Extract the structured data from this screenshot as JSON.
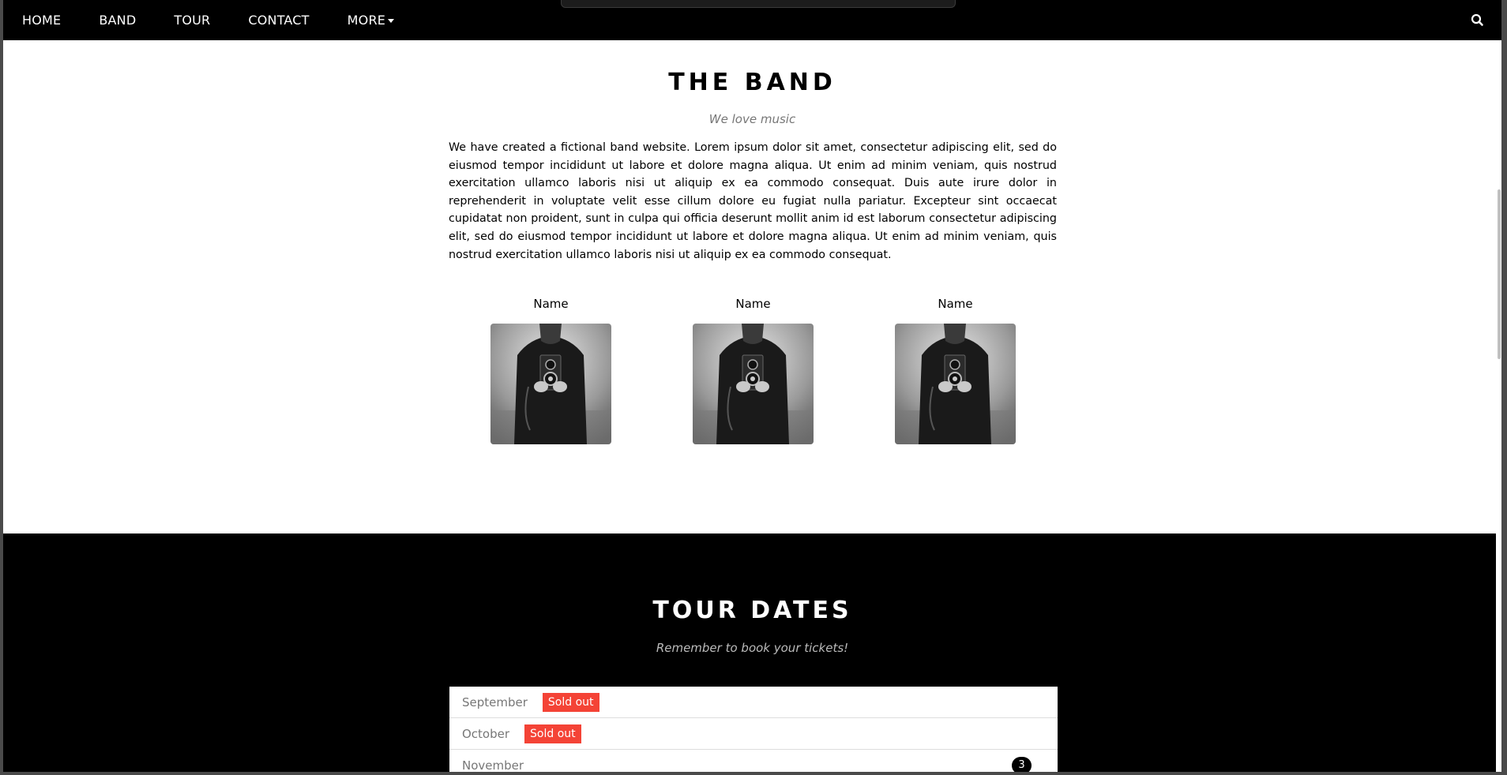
{
  "nav": {
    "items": [
      "HOME",
      "BAND",
      "TOUR",
      "CONTACT",
      "MORE"
    ],
    "search_icon": "search-icon"
  },
  "band": {
    "title": "THE BAND",
    "subtitle": "We love music",
    "description": "We have created a fictional band website. Lorem ipsum dolor sit amet, consectetur adipiscing elit, sed do eiusmod tempor incididunt ut labore et dolore magna aliqua. Ut enim ad minim veniam, quis nostrud exercitation ullamco laboris nisi ut aliquip ex ea commodo consequat. Duis aute irure dolor in reprehenderit in voluptate velit esse cillum dolore eu fugiat nulla pariatur. Excepteur sint occaecat cupidatat non proident, sunt in culpa qui officia deserunt mollit anim id est laborum consectetur adipiscing elit, sed do eiusmod tempor incididunt ut labore et dolore magna aliqua. Ut enim ad minim veniam, quis nostrud exercitation ullamco laboris nisi ut aliquip ex ea commodo consequat.",
    "members": [
      {
        "name": "Name"
      },
      {
        "name": "Name"
      },
      {
        "name": "Name"
      }
    ]
  },
  "tour": {
    "title": "TOUR DATES",
    "subtitle": "Remember to book your tickets!",
    "dates": [
      {
        "month": "September",
        "badge": "Sold out"
      },
      {
        "month": "October",
        "badge": "Sold out"
      },
      {
        "month": "November",
        "count": "3"
      }
    ]
  },
  "colors": {
    "navbar": "#000000",
    "sold_out": "#f44336",
    "tour_bg": "#000000"
  }
}
